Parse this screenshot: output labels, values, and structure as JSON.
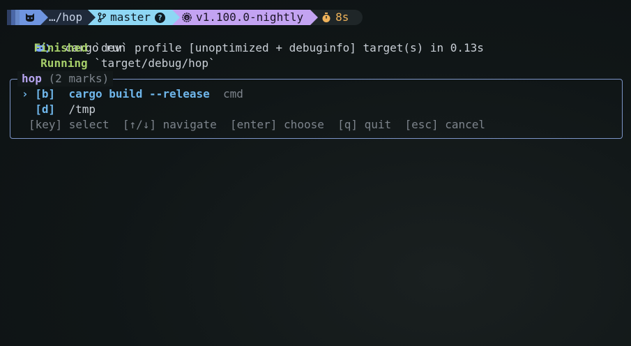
{
  "prompt_bar": {
    "cat_icon": "cat-icon",
    "directory": "…/hop",
    "branch_icon": "git-branch-icon",
    "branch": "master",
    "branch_status": "?",
    "rust_icon": "rust-icon",
    "version": "v1.100.0-nightly",
    "timer_icon": "stopwatch-icon",
    "duration": "8s"
  },
  "shell": {
    "prompt_icon": "cat-icon",
    "prompt_chevron": "❯",
    "command": "cargo run"
  },
  "output": {
    "finished_label": "Finished",
    "finished_text": "`dev` profile [unoptimized + debuginfo] target(s) in 0.13s",
    "running_label": "Running",
    "running_text": "`target/debug/hop`"
  },
  "hop": {
    "title": "hop",
    "count": "(2 marks)",
    "selector": "›",
    "marks": [
      {
        "key": "[b]",
        "value": "cargo build --release",
        "type": "cmd"
      },
      {
        "key": "[d]",
        "value": "/tmp",
        "type": ""
      }
    ],
    "help": "[key] select  [↑/↓] navigate  [enter] choose  [q] quit  [esc] cancel"
  },
  "colors": {
    "background": "#0f1516",
    "accent_blue": "#6fb6ea",
    "accent_purple": "#b6a4ef",
    "success_green": "#a6cf6a",
    "timer_orange": "#f0b35a",
    "border": "#7d95c8"
  }
}
